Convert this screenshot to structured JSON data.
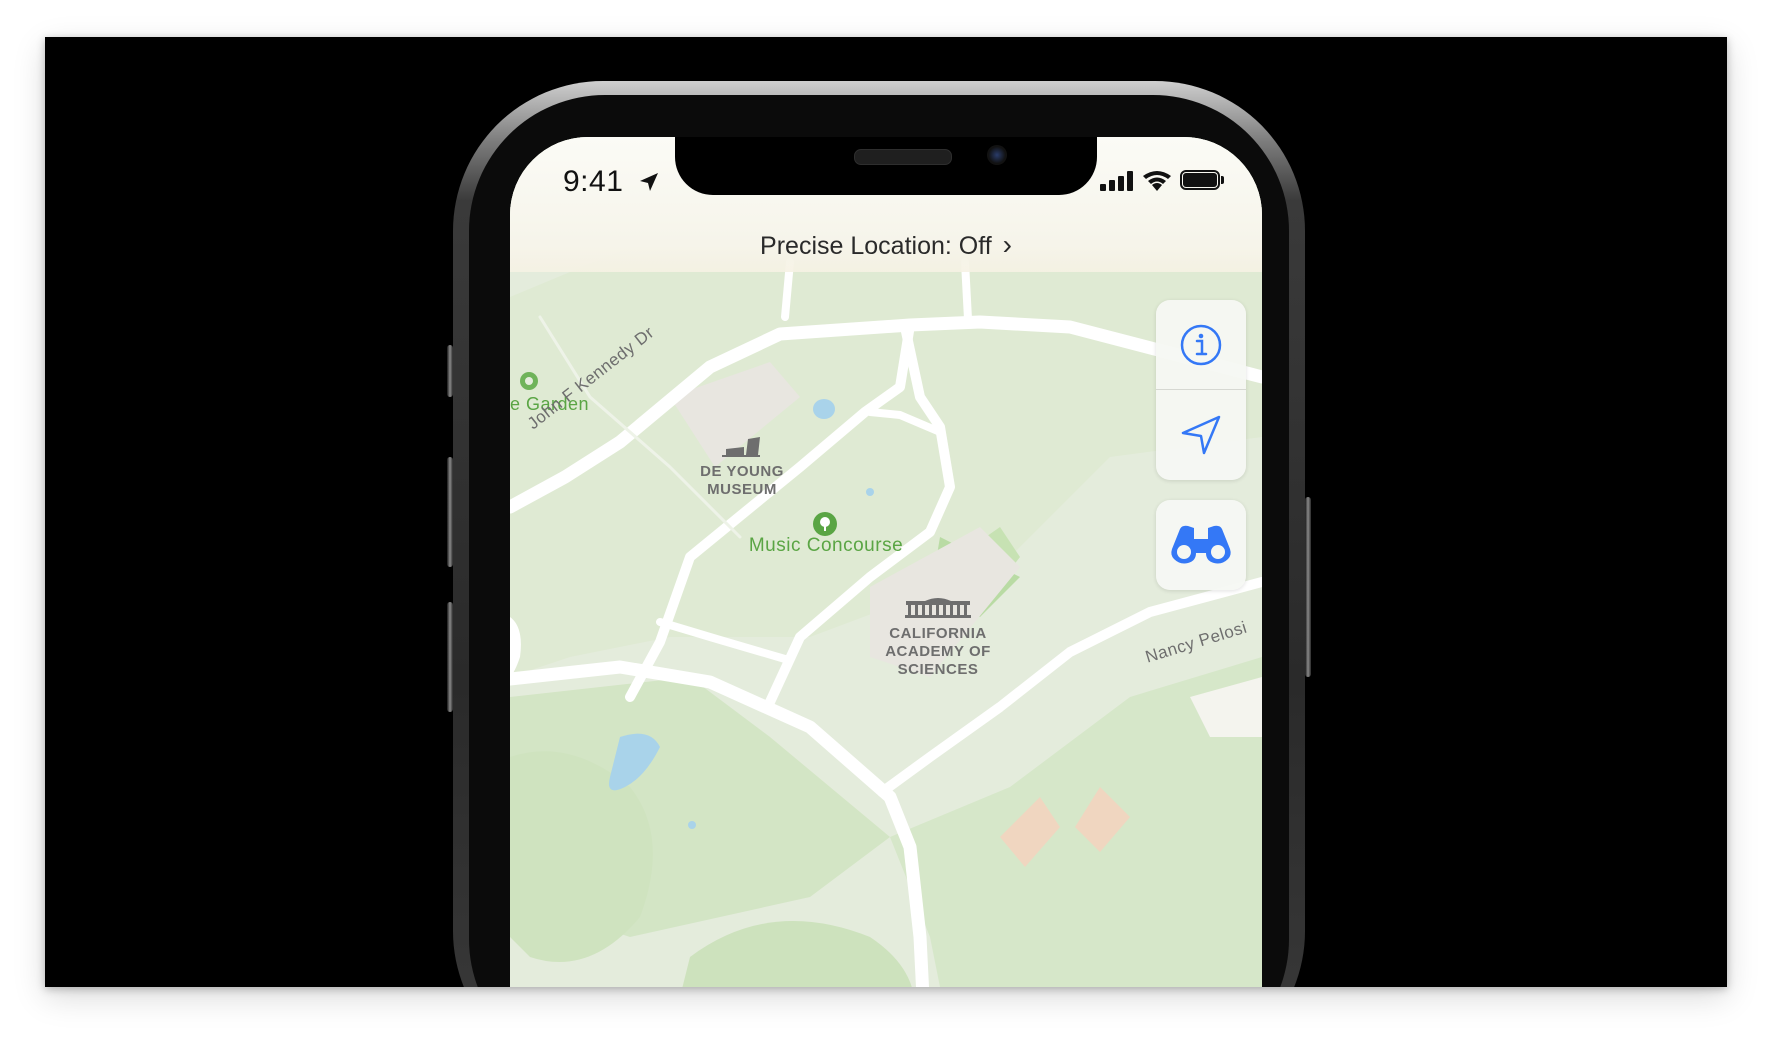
{
  "status_bar": {
    "time": "9:41",
    "location_icon": "location-arrow-icon",
    "signal_icon": "cellular-signal-icon",
    "wifi_icon": "wifi-icon",
    "battery_icon": "battery-icon"
  },
  "precise_location": {
    "label": "Precise Location: Off",
    "chevron": "›"
  },
  "map": {
    "labels": {
      "garden": "e Garden",
      "jfk_drive": "John F Kennedy Dr",
      "de_young_line1": "DE YOUNG",
      "de_young_line2": "MUSEUM",
      "music_concourse": "Music Concourse",
      "academy_line1": "CALIFORNIA",
      "academy_line2": "ACADEMY OF",
      "academy_line3": "SCIENCES",
      "nancy_pelosi": "Nancy Pelosi"
    },
    "colors": {
      "land": "#e4ecdc",
      "park": "#d2e6c4",
      "road": "#ffffff",
      "water": "#a9d3ea",
      "poi_green": "#5aa544",
      "label_gray": "#6e6e6e"
    }
  },
  "controls": {
    "info_icon": "info-icon",
    "locate_icon": "navigation-arrow-icon",
    "lookaround_icon": "binoculars-icon",
    "accent": "#3478f6"
  }
}
